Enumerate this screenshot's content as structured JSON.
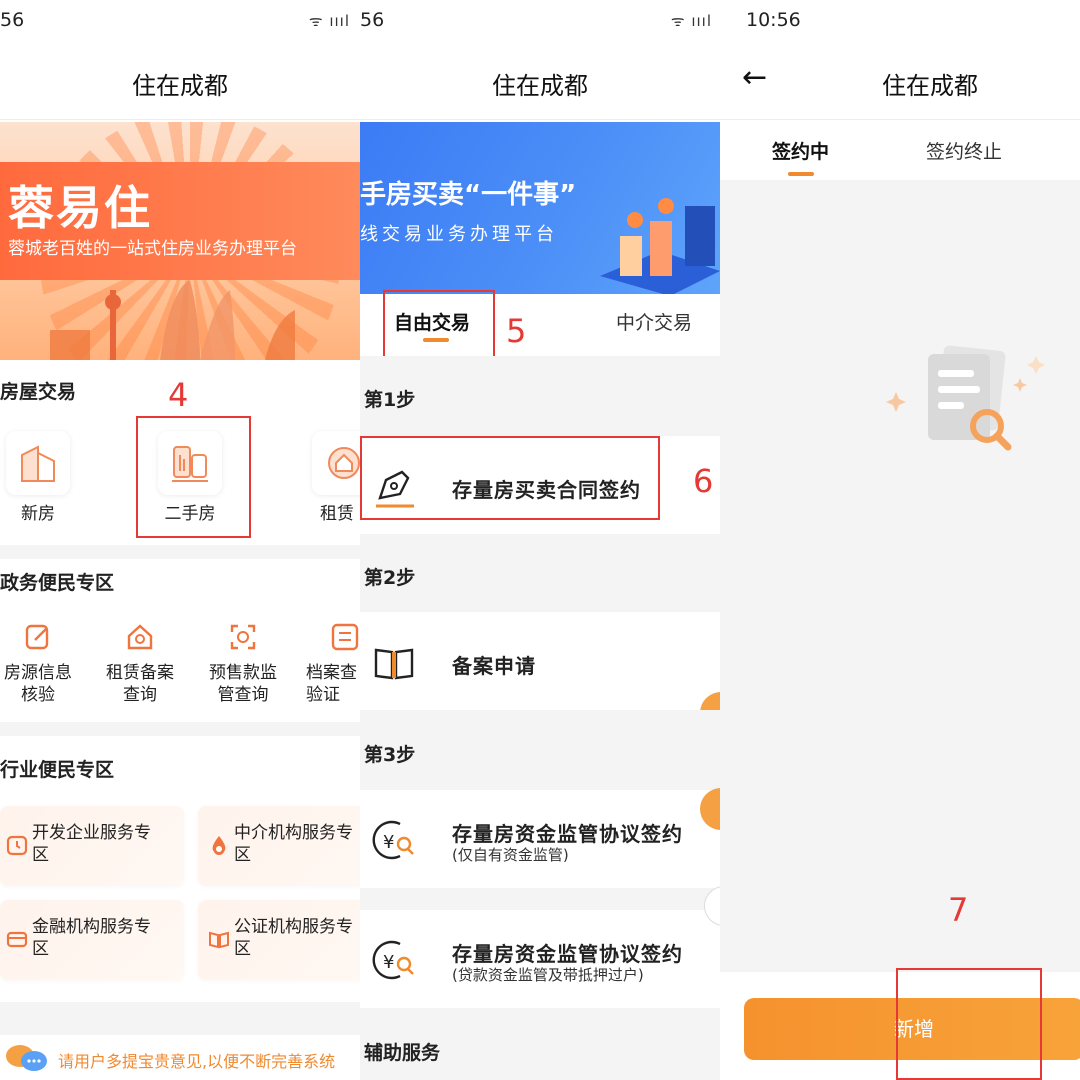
{
  "panel1": {
    "status_time": "56",
    "status_signal": "ᯤ ıııl",
    "title": "住在成都",
    "hero": {
      "brand": "蓉易住",
      "slogan": "蓉城老百姓的一站式住房业务办理平台"
    },
    "housing": {
      "title": "房屋交易",
      "items": [
        {
          "label": "新房",
          "icon": "building-icon"
        },
        {
          "label": "二手房",
          "icon": "second-hand-house-icon"
        },
        {
          "label": "租赁",
          "icon": "rental-icon"
        }
      ]
    },
    "gov": {
      "title": "政务便民专区",
      "items": [
        {
          "label": "房源信息\n核验",
          "icon": "edit-icon"
        },
        {
          "label": "租赁备案\n查询",
          "icon": "house-search-icon"
        },
        {
          "label": "预售款监\n管查询",
          "icon": "scan-money-icon"
        },
        {
          "label": "档案查\n验证",
          "icon": "checklist-icon"
        }
      ]
    },
    "industry": {
      "title": "行业便民专区",
      "items": [
        {
          "label": "开发企业服务专区",
          "icon": "clock-icon"
        },
        {
          "label": "中介机构服务专区",
          "icon": "drop-icon"
        },
        {
          "label": "金融机构服务专区",
          "icon": "card-icon"
        },
        {
          "label": "公证机构服务专区",
          "icon": "book-icon"
        }
      ]
    },
    "notice": "请用户多提宝贵意见,以便不断完善系统",
    "annotation": "4"
  },
  "panel2": {
    "status_time": "56",
    "status_signal": "ᯤ ıııl",
    "title": "住在成都",
    "hero": {
      "headline": "手房买卖“一件事”",
      "sub": "线交易业务办理平台"
    },
    "tabs": [
      "自由交易",
      "中介交易"
    ],
    "steps": [
      {
        "title": "第1步",
        "items": [
          {
            "title": "存量房买卖合同签约",
            "sub": ""
          }
        ]
      },
      {
        "title": "第2步",
        "items": [
          {
            "title": "备案申请",
            "sub": ""
          }
        ]
      },
      {
        "title": "第3步",
        "items": [
          {
            "title": "存量房资金监管协议签约",
            "sub": "(仅自有资金监管)"
          },
          {
            "title": "存量房资金监管协议签约",
            "sub": "(贷款资金监管及带抵押过户)"
          }
        ]
      }
    ],
    "aux_title": "辅助服务",
    "annotations": [
      "5",
      "6"
    ]
  },
  "panel3": {
    "status_time": "10:56",
    "title": "住在成都",
    "tabs": [
      "签约中",
      "签约终止"
    ],
    "add_button": "新增",
    "annotation": "7"
  },
  "colors": {
    "accent": "#f08a2f",
    "brand_orange": "#ff6a3d",
    "banner_blue": "#3b7bf5",
    "annotation_red": "#e53935"
  }
}
